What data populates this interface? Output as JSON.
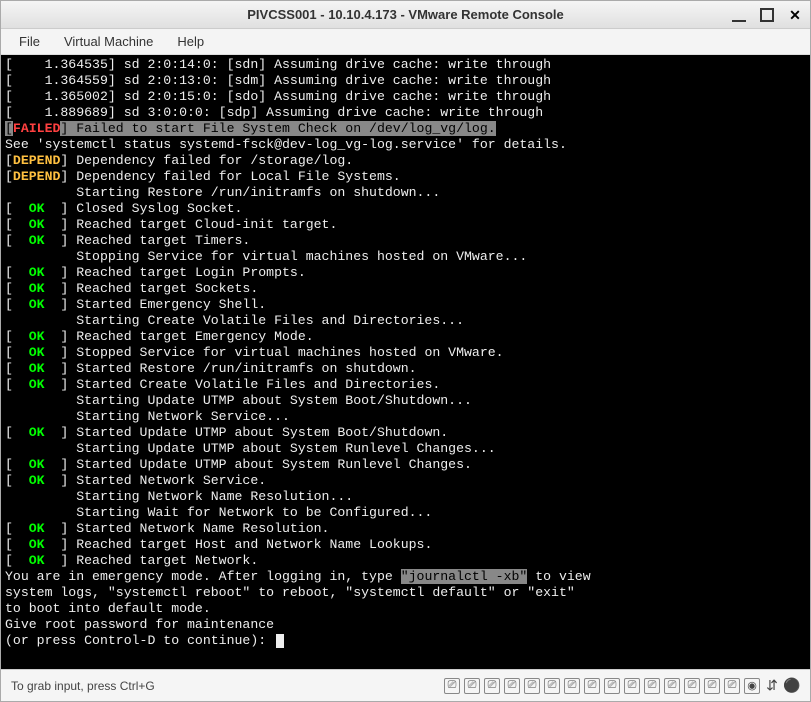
{
  "window": {
    "title": "PIVCSS001 - 10.10.4.173 - VMware Remote Console"
  },
  "menu": {
    "file": "File",
    "vm": "Virtual Machine",
    "help": "Help"
  },
  "console_lines": [
    {
      "segs": [
        {
          "t": "[    1.364535] sd 2:0:14:0: [sdn] Assuming drive cache: write through"
        }
      ]
    },
    {
      "segs": [
        {
          "t": "[    1.364559] sd 2:0:13:0: [sdm] Assuming drive cache: write through"
        }
      ]
    },
    {
      "segs": [
        {
          "t": "[    1.365002] sd 2:0:15:0: [sdo] Assuming drive cache: write through"
        }
      ]
    },
    {
      "segs": [
        {
          "t": "[    1.889689] sd 3:0:0:0: [sdp] Assuming drive cache: write through"
        }
      ]
    },
    {
      "segs": [
        {
          "t": "[",
          "c": "hl"
        },
        {
          "t": "FAILED",
          "c": "failed"
        },
        {
          "t": "] Failed to start File System Check on /dev/log_vg/log.",
          "c": "hl"
        }
      ]
    },
    {
      "segs": [
        {
          "t": "See 'systemctl status systemd-fsck@dev-log_vg-log.service' for details."
        }
      ]
    },
    {
      "segs": [
        {
          "t": "["
        },
        {
          "t": "DEPEND",
          "c": "depend"
        },
        {
          "t": "] Dependency failed for /storage/log."
        }
      ]
    },
    {
      "segs": [
        {
          "t": "["
        },
        {
          "t": "DEPEND",
          "c": "depend"
        },
        {
          "t": "] Dependency failed for Local File Systems."
        }
      ]
    },
    {
      "segs": [
        {
          "t": "         Starting Restore /run/initramfs on shutdown..."
        }
      ]
    },
    {
      "segs": [
        {
          "t": "[  "
        },
        {
          "t": "OK",
          "c": "ok"
        },
        {
          "t": "  ] Closed Syslog Socket."
        }
      ]
    },
    {
      "segs": [
        {
          "t": "[  "
        },
        {
          "t": "OK",
          "c": "ok"
        },
        {
          "t": "  ] Reached target Cloud-init target."
        }
      ]
    },
    {
      "segs": [
        {
          "t": "[  "
        },
        {
          "t": "OK",
          "c": "ok"
        },
        {
          "t": "  ] Reached target Timers."
        }
      ]
    },
    {
      "segs": [
        {
          "t": "         Stopping Service for virtual machines hosted on VMware..."
        }
      ]
    },
    {
      "segs": [
        {
          "t": "[  "
        },
        {
          "t": "OK",
          "c": "ok"
        },
        {
          "t": "  ] Reached target Login Prompts."
        }
      ]
    },
    {
      "segs": [
        {
          "t": "[  "
        },
        {
          "t": "OK",
          "c": "ok"
        },
        {
          "t": "  ] Reached target Sockets."
        }
      ]
    },
    {
      "segs": [
        {
          "t": "[  "
        },
        {
          "t": "OK",
          "c": "ok"
        },
        {
          "t": "  ] Started Emergency Shell."
        }
      ]
    },
    {
      "segs": [
        {
          "t": "         Starting Create Volatile Files and Directories..."
        }
      ]
    },
    {
      "segs": [
        {
          "t": "[  "
        },
        {
          "t": "OK",
          "c": "ok"
        },
        {
          "t": "  ] Reached target Emergency Mode."
        }
      ]
    },
    {
      "segs": [
        {
          "t": "[  "
        },
        {
          "t": "OK",
          "c": "ok"
        },
        {
          "t": "  ] Stopped Service for virtual machines hosted on VMware."
        }
      ]
    },
    {
      "segs": [
        {
          "t": "[  "
        },
        {
          "t": "OK",
          "c": "ok"
        },
        {
          "t": "  ] Started Restore /run/initramfs on shutdown."
        }
      ]
    },
    {
      "segs": [
        {
          "t": "[  "
        },
        {
          "t": "OK",
          "c": "ok"
        },
        {
          "t": "  ] Started Create Volatile Files and Directories."
        }
      ]
    },
    {
      "segs": [
        {
          "t": "         Starting Update UTMP about System Boot/Shutdown..."
        }
      ]
    },
    {
      "segs": [
        {
          "t": "         Starting Network Service..."
        }
      ]
    },
    {
      "segs": [
        {
          "t": "[  "
        },
        {
          "t": "OK",
          "c": "ok"
        },
        {
          "t": "  ] Started Update UTMP about System Boot/Shutdown."
        }
      ]
    },
    {
      "segs": [
        {
          "t": "         Starting Update UTMP about System Runlevel Changes..."
        }
      ]
    },
    {
      "segs": [
        {
          "t": "[  "
        },
        {
          "t": "OK",
          "c": "ok"
        },
        {
          "t": "  ] Started Update UTMP about System Runlevel Changes."
        }
      ]
    },
    {
      "segs": [
        {
          "t": "[  "
        },
        {
          "t": "OK",
          "c": "ok"
        },
        {
          "t": "  ] Started Network Service."
        }
      ]
    },
    {
      "segs": [
        {
          "t": "         Starting Network Name Resolution..."
        }
      ]
    },
    {
      "segs": [
        {
          "t": "         Starting Wait for Network to be Configured..."
        }
      ]
    },
    {
      "segs": [
        {
          "t": "[  "
        },
        {
          "t": "OK",
          "c": "ok"
        },
        {
          "t": "  ] Started Network Name Resolution."
        }
      ]
    },
    {
      "segs": [
        {
          "t": "[  "
        },
        {
          "t": "OK",
          "c": "ok"
        },
        {
          "t": "  ] Reached target Host and Network Name Lookups."
        }
      ]
    },
    {
      "segs": [
        {
          "t": "[  "
        },
        {
          "t": "OK",
          "c": "ok"
        },
        {
          "t": "  ] Reached target Network."
        }
      ]
    },
    {
      "segs": [
        {
          "t": "You are in emergency mode. After logging in, type "
        },
        {
          "t": "\"journalctl -xb\"",
          "c": "hl"
        },
        {
          "t": " to view"
        }
      ]
    },
    {
      "segs": [
        {
          "t": "system logs, \"systemctl reboot\" to reboot, \"systemctl default\" or \"exit\""
        }
      ]
    },
    {
      "segs": [
        {
          "t": "to boot into default mode."
        }
      ]
    },
    {
      "segs": [
        {
          "t": "Give root password for maintenance"
        }
      ]
    },
    {
      "segs": [
        {
          "t": "(or press Control-D to continue): "
        }
      ],
      "cursor": true
    }
  ],
  "status": {
    "hint": "To grab input, press Ctrl+G"
  },
  "status_icons": [
    {
      "name": "device-icon-1",
      "glyph": "⎚"
    },
    {
      "name": "device-icon-2",
      "glyph": "⎚"
    },
    {
      "name": "device-icon-3",
      "glyph": "⎚"
    },
    {
      "name": "device-icon-4",
      "glyph": "⎚"
    },
    {
      "name": "device-icon-5",
      "glyph": "⎚"
    },
    {
      "name": "device-icon-6",
      "glyph": "⎚"
    },
    {
      "name": "device-icon-7",
      "glyph": "⎚"
    },
    {
      "name": "device-icon-8",
      "glyph": "⎚"
    },
    {
      "name": "device-icon-9",
      "glyph": "⎚"
    },
    {
      "name": "device-icon-10",
      "glyph": "⎚"
    },
    {
      "name": "device-icon-11",
      "glyph": "⎚"
    },
    {
      "name": "device-icon-12",
      "glyph": "⎚"
    },
    {
      "name": "device-icon-13",
      "glyph": "⎚"
    },
    {
      "name": "device-icon-14",
      "glyph": "⎚"
    },
    {
      "name": "device-icon-15",
      "glyph": "⎚"
    },
    {
      "name": "cdrom-icon",
      "glyph": "◉"
    },
    {
      "name": "network-icon",
      "glyph": "⇵"
    },
    {
      "name": "connected-icon",
      "glyph": "⚫"
    }
  ]
}
